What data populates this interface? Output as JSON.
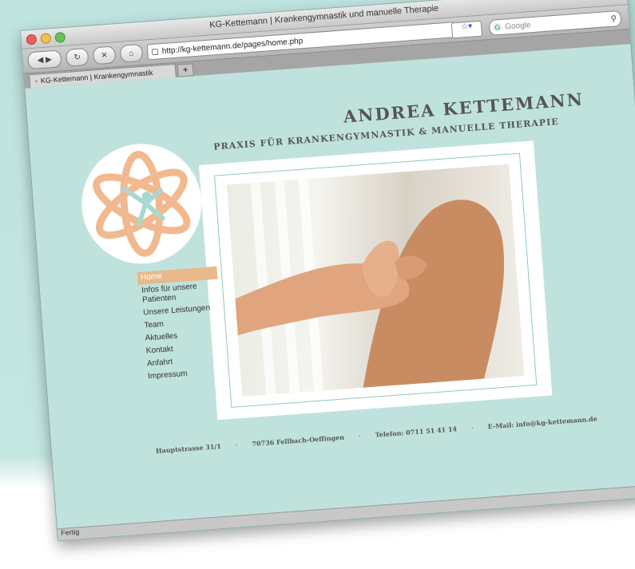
{
  "window": {
    "title": "KG-Kettemann | Krankengymnastik und manuelle Therapie",
    "url": "http://kg-kettemann.de/pages/home.php",
    "search_placeholder": "Google",
    "tab_title": "KG-Kettemann | Krankengymnastik",
    "new_tab": "+",
    "status": "Fertig"
  },
  "toolbar_icons": [
    "back-icon",
    "forward-icon",
    "reload-icon",
    "stop-icon",
    "home-icon"
  ],
  "site": {
    "name": "ANDREA KETTEMANN",
    "subtitle": "PRAXIS FÜR KRANKENGYMNASTIK & MANUELLE THERAPIE",
    "nav": [
      {
        "label": "Home",
        "active": true
      },
      {
        "label": "Infos für unsere Patienten",
        "active": false
      },
      {
        "label": "Unsere Leistungen",
        "active": false
      },
      {
        "label": "Team",
        "active": false
      },
      {
        "label": "Aktuelles",
        "active": false
      },
      {
        "label": "Kontakt",
        "active": false
      },
      {
        "label": "Anfahrt",
        "active": false
      },
      {
        "label": "Impressum",
        "active": false
      }
    ],
    "footer": {
      "street": "Hauptstrasse 31/1",
      "city": "70736 Fellbach-Oeffingen",
      "phone": "Telefon: 0711 51 41 14",
      "email": "E-Mail: info@kg-kettemann.de",
      "separator": "·"
    }
  },
  "colors": {
    "accent": "#e8b98a",
    "background": "#c0e2dd",
    "logo_teal": "#a9d8d1"
  }
}
